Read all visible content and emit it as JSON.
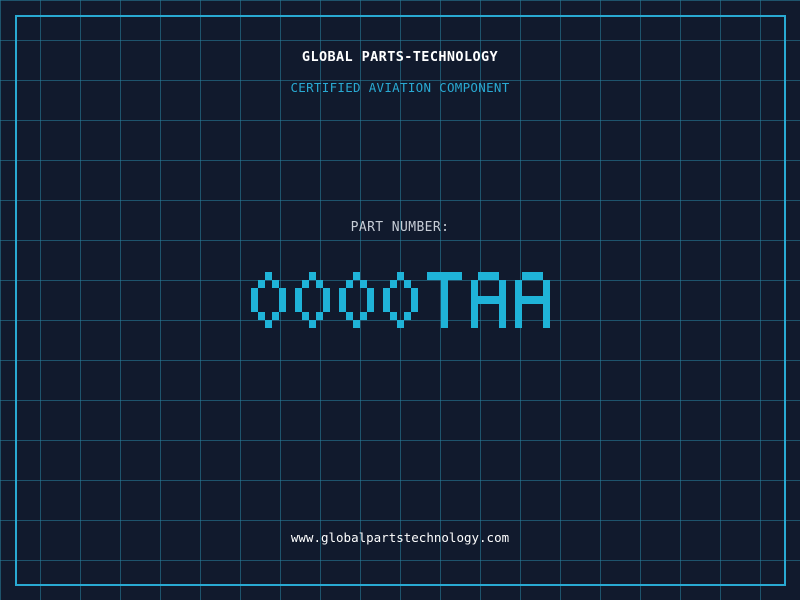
{
  "company": {
    "name": "GLOBAL PARTS-TECHNOLOGY"
  },
  "tagline": "CERTIFIED AVIATION COMPONENT",
  "part": {
    "label": "PART NUMBER:",
    "number": "0000TAA"
  },
  "footer": {
    "website": "www.globalpartstechnology.com"
  },
  "colors": {
    "background": "#111a2d",
    "grid": "#1f6f8c",
    "accent": "#29a9d2",
    "part_number": "#1fb3d8",
    "text_primary": "#ffffff",
    "text_muted": "#c7cdd6"
  }
}
